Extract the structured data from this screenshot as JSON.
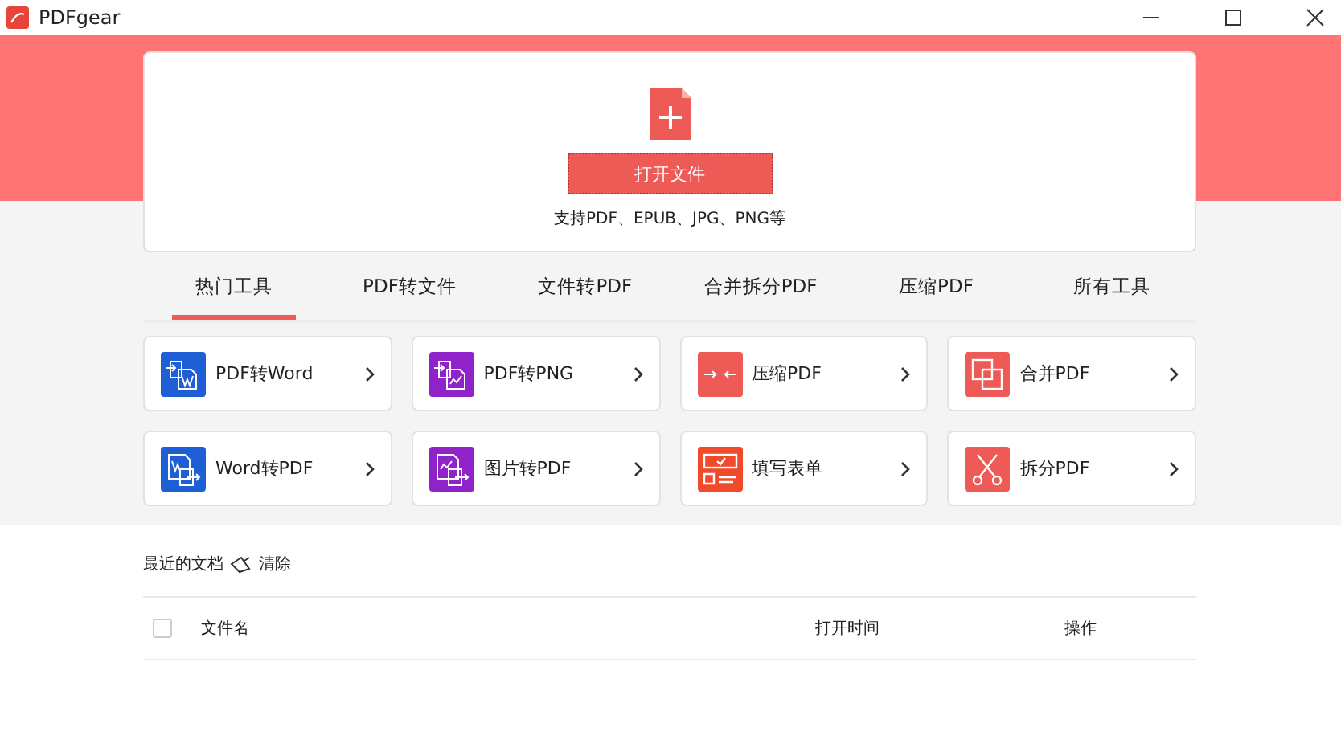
{
  "window": {
    "title": "PDFgear"
  },
  "open_panel": {
    "button": "打开文件",
    "hint": "支持PDF、EPUB、JPG、PNG等"
  },
  "tabs": [
    {
      "label": "热门工具",
      "selected": true
    },
    {
      "label": "PDF转文件",
      "selected": false
    },
    {
      "label": "文件转PDF",
      "selected": false
    },
    {
      "label": "合并拆分PDF",
      "selected": false
    },
    {
      "label": "压缩PDF",
      "selected": false
    },
    {
      "label": "所有工具",
      "selected": false
    }
  ],
  "tools": [
    {
      "label": "PDF转Word",
      "kind": "to-word",
      "color": "#1e5fd6"
    },
    {
      "label": "PDF转PNG",
      "kind": "to-image",
      "color": "#8f23c9"
    },
    {
      "label": "压缩PDF",
      "kind": "compress",
      "color": "#ee5a55"
    },
    {
      "label": "合并PDF",
      "kind": "merge",
      "color": "#ee5a55"
    },
    {
      "label": "Word转PDF",
      "kind": "from-word",
      "color": "#1e5fd6"
    },
    {
      "label": "图片转PDF",
      "kind": "from-image",
      "color": "#8f23c9"
    },
    {
      "label": "填写表单",
      "kind": "form",
      "color": "#f04a2a"
    },
    {
      "label": "拆分PDF",
      "kind": "split",
      "color": "#ee5a55"
    }
  ],
  "recent": {
    "title": "最近的文档",
    "clear": "清除",
    "select_all_checked": false,
    "columns": [
      "文件名",
      "打开时间",
      "操作"
    ]
  }
}
